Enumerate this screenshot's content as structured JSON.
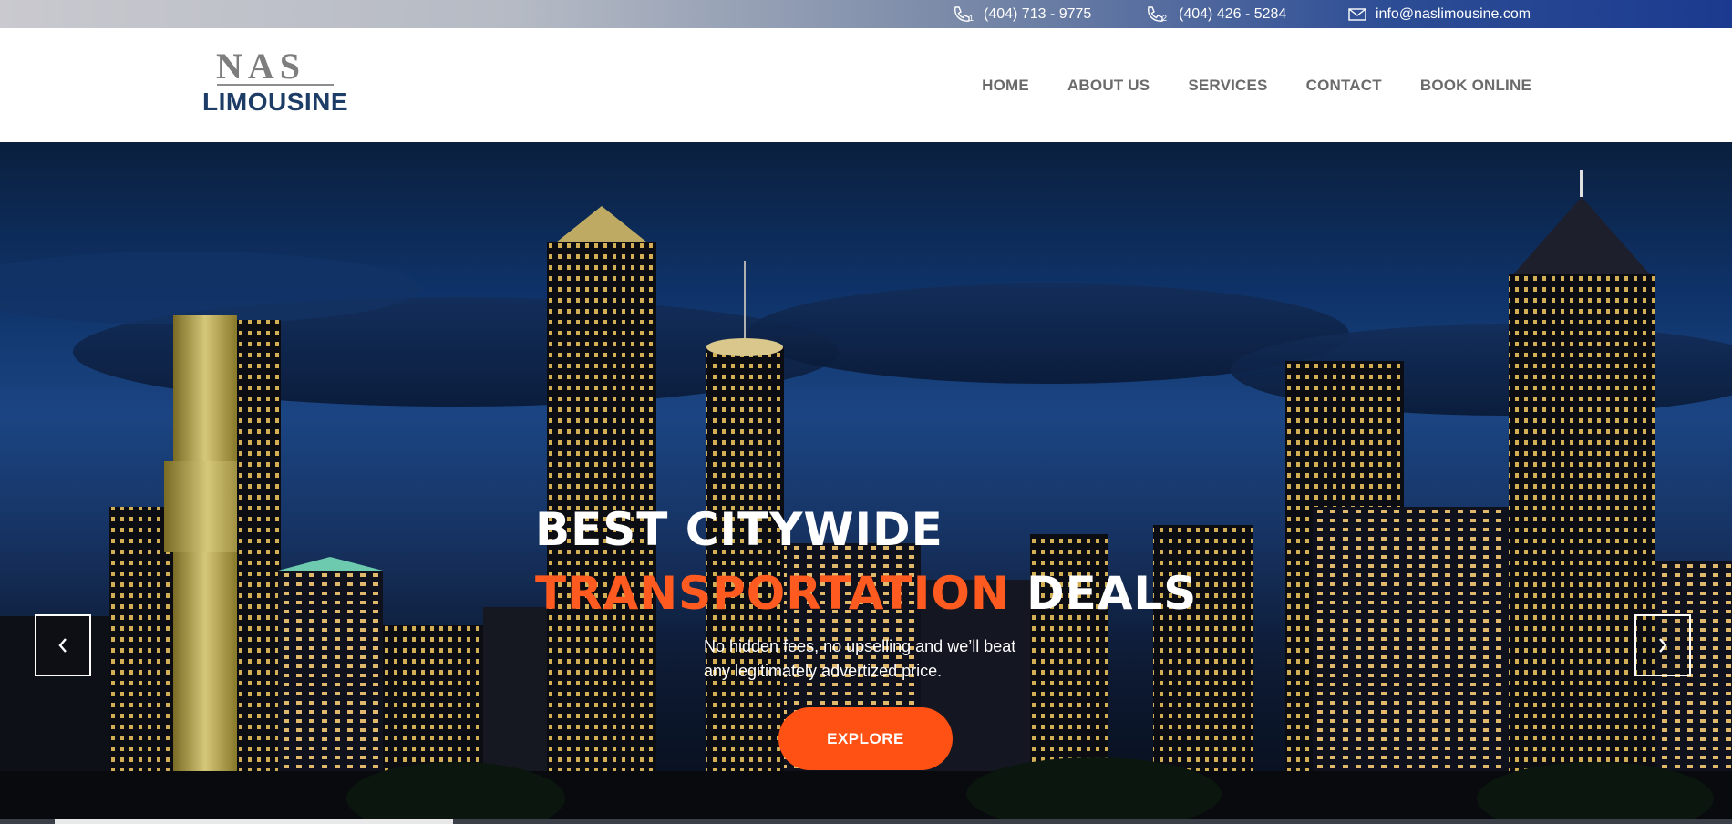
{
  "topbar": {
    "phone1": "(404) 713 - 9775",
    "phone1_icon_num": "1",
    "phone2": "(404) 426 - 5284",
    "phone2_icon_num": "2",
    "email": "info@naslimousine.com"
  },
  "logo": {
    "top": "NAS",
    "bottom": "LIMOUSINE"
  },
  "nav": {
    "home": "HOME",
    "about": "ABOUT US",
    "services": "SERVICES",
    "contact": "CONTACT",
    "book": "BOOK ONLINE"
  },
  "hero": {
    "headline_line1": "BEST CITYWIDE",
    "headline_accent": "TRANSPORTATION",
    "headline_rest": " DEALS",
    "subtext_line1": "No hidden fees, no upselling and we’ll beat",
    "subtext_line2": "any legitimately advertized price.",
    "cta": "EXPLORE",
    "slider_progress": 0.23
  },
  "colors": {
    "accent": "#ff5113",
    "logo_blue": "#1e3d66",
    "nav_text": "#6b6b6b"
  },
  "icons": {
    "phone": "phone-icon",
    "mail": "mail-icon",
    "prev": "chevron-left-icon",
    "next": "chevron-right-icon"
  }
}
